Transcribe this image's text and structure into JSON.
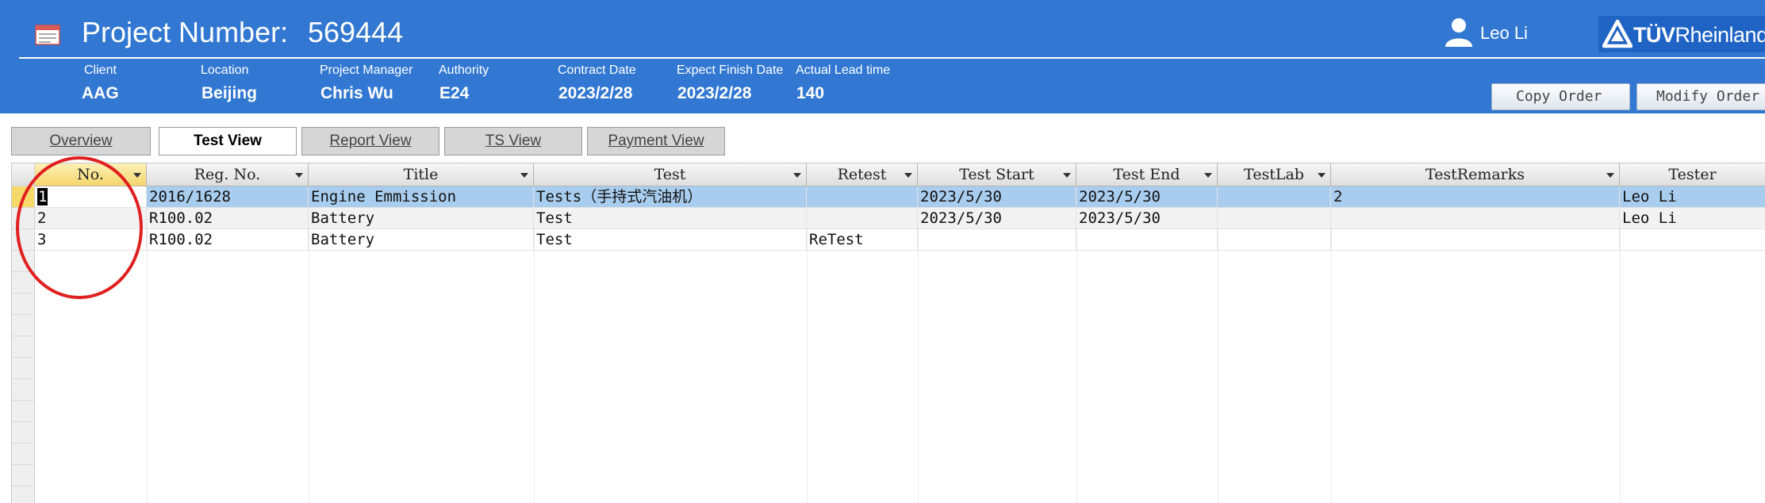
{
  "header": {
    "project_label": "Project Number:",
    "project_number": "569444",
    "user_name": "Leo Li",
    "brand": {
      "bold": "TÜV",
      "rest": "Rheinland"
    },
    "fields": [
      {
        "label": "Client",
        "value": "AAG"
      },
      {
        "label": "Location",
        "value": "Beijing"
      },
      {
        "label": "Project Manager",
        "value": "Chris Wu"
      },
      {
        "label": "Authority",
        "value": "E24"
      },
      {
        "label": "Contract Date",
        "value": "2023/2/28"
      },
      {
        "label": "Expect Finish Date",
        "value": "2023/2/28"
      },
      {
        "label": "Actual Lead time",
        "value": "140"
      }
    ],
    "copy_order_label": "Copy Order",
    "modify_order_label": "Modify Order",
    "accent_color": "#3278d2"
  },
  "tabs": [
    {
      "label": "Overview",
      "active": false
    },
    {
      "label": "Test View",
      "active": true
    },
    {
      "label": "Report View",
      "active": false
    },
    {
      "label": "TS View",
      "active": false
    },
    {
      "label": "Payment View",
      "active": false
    }
  ],
  "grid": {
    "columns": [
      "No.",
      "Reg. No.",
      "Title",
      "Test",
      "Retest",
      "Test Start",
      "Test End",
      "TestLab",
      "TestRemarks",
      "Tester"
    ],
    "rows": [
      {
        "no": "1",
        "reg_no": "2016/1628",
        "title": "Engine Emmission",
        "test": "Tests（手持式汽油机）",
        "retest": "",
        "test_start": "2023/5/30",
        "test_end": "2023/5/30",
        "test_lab": "",
        "test_remarks": "2",
        "tester": "Leo Li"
      },
      {
        "no": "2",
        "reg_no": "R100.02",
        "title": "Battery",
        "test": "Test",
        "retest": "",
        "test_start": "2023/5/30",
        "test_end": "2023/5/30",
        "test_lab": "",
        "test_remarks": "",
        "tester": "Leo Li"
      },
      {
        "no": "3",
        "reg_no": "R100.02",
        "title": "Battery",
        "test": "Test",
        "retest": "ReTest",
        "test_start": "",
        "test_end": "",
        "test_lab": "",
        "test_remarks": "",
        "tester": ""
      }
    ],
    "selected_row": 1,
    "selection_color": "#a9cdef",
    "annotation_color": "#e02020"
  }
}
